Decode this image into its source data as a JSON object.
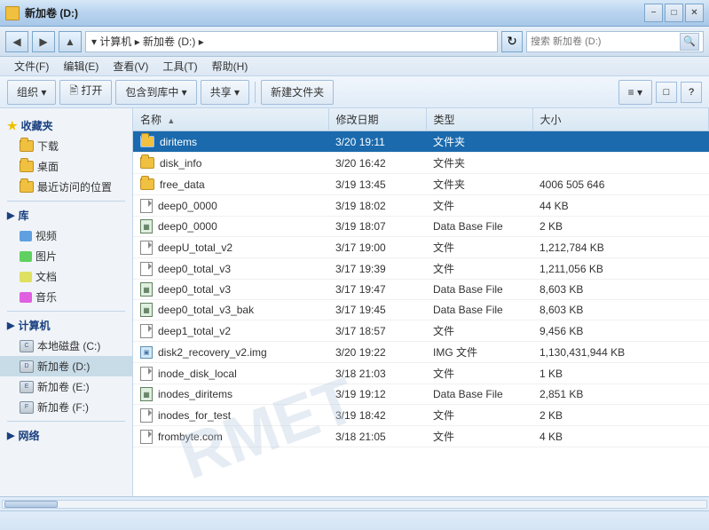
{
  "titleBar": {
    "title": "新加卷 (D:)",
    "icon": "folder",
    "minimizeLabel": "−",
    "maximizeLabel": "□",
    "closeLabel": "✕"
  },
  "addressBar": {
    "backLabel": "◀",
    "forwardLabel": "▶",
    "upLabel": "▲",
    "path": "▾  计算机 ▸ 新加卷 (D:) ▸",
    "refreshLabel": "↻",
    "searchPlaceholder": "搜索 新加卷 (D:)",
    "searchBtnLabel": "🔍"
  },
  "menuBar": {
    "items": [
      {
        "label": "文件(F)"
      },
      {
        "label": "编辑(E)"
      },
      {
        "label": "查看(V)"
      },
      {
        "label": "工具(T)"
      },
      {
        "label": "帮助(H)"
      }
    ]
  },
  "toolbar": {
    "organizeLabel": "组织 ▾",
    "openLabel": "🖹 打开",
    "includeLabel": "包含到库中 ▾",
    "shareLabel": "共享 ▾",
    "newFolderLabel": "新建文件夹",
    "viewLabel": "≡ ▾",
    "viewBtn1": "□",
    "viewBtn2": "?"
  },
  "sidebar": {
    "favoritesStar": "★",
    "favoritesLabel": "收藏夹",
    "downloadLabel": "下载",
    "desktopLabel": "桌面",
    "recentLabel": "最近访问的位置",
    "libraryLabel": "库",
    "videoLabel": "视频",
    "imageLabel": "图片",
    "docLabel": "文档",
    "musicLabel": "音乐",
    "computerLabel": "计算机",
    "localDiskLabel": "本地磁盘 (C:)",
    "newVol1Label": "新加卷 (D:)",
    "newVol2Label": "新加卷 (E:)",
    "newVol3Label": "新加卷 (F:)",
    "networkLabel": "网络"
  },
  "fileList": {
    "columns": [
      {
        "key": "name",
        "label": "名称",
        "sortArrow": "▲"
      },
      {
        "key": "modified",
        "label": "修改日期"
      },
      {
        "key": "type",
        "label": "类型"
      },
      {
        "key": "size",
        "label": "大小"
      }
    ],
    "rows": [
      {
        "name": "diritems",
        "modified": "3/20 19:11",
        "type": "文件夹",
        "size": "",
        "iconType": "folder",
        "selected": true
      },
      {
        "name": "disk_info",
        "modified": "3/20 16:42",
        "type": "文件夹",
        "size": "",
        "iconType": "folder",
        "selected": false
      },
      {
        "name": "free_data",
        "modified": "3/19 13:45",
        "type": "文件夹",
        "size": "4006 505 646",
        "iconType": "folder",
        "selected": false
      },
      {
        "name": "deep0_0000",
        "modified": "3/19 18:02",
        "type": "文件",
        "size": "44 KB",
        "iconType": "file",
        "selected": false
      },
      {
        "name": "deep0_0000",
        "modified": "3/19 18:07",
        "type": "Data Base File",
        "size": "2 KB",
        "iconType": "db",
        "selected": false
      },
      {
        "name": "deepU_total_v2",
        "modified": "3/17 19:00",
        "type": "文件",
        "size": "1,212,784 KB",
        "iconType": "file",
        "selected": false
      },
      {
        "name": "deep0_total_v3",
        "modified": "3/17 19:39",
        "type": "文件",
        "size": "1,211,056 KB",
        "iconType": "file",
        "selected": false
      },
      {
        "name": "deep0_total_v3",
        "modified": "3/17 19:47",
        "type": "Data Base File",
        "size": "8,603 KB",
        "iconType": "db",
        "selected": false
      },
      {
        "name": "deep0_total_v3_bak",
        "modified": "3/17 19:45",
        "type": "Data Base File",
        "size": "8,603 KB",
        "iconType": "db",
        "selected": false
      },
      {
        "name": "deep1_total_v2",
        "modified": "3/17 18:57",
        "type": "文件",
        "size": "9,456 KB",
        "iconType": "file",
        "selected": false
      },
      {
        "name": "disk2_recovery_v2.img",
        "modified": "3/20 19:22",
        "type": "IMG 文件",
        "size": "1,130,431,944 KB",
        "iconType": "img",
        "selected": false
      },
      {
        "name": "inode_disk_local",
        "modified": "3/18 21:03",
        "type": "文件",
        "size": "1 KB",
        "iconType": "file",
        "selected": false
      },
      {
        "name": "inodes_diritems",
        "modified": "3/19 19:12",
        "type": "Data Base File",
        "size": "2,851 KB",
        "iconType": "db",
        "selected": false
      },
      {
        "name": "inodes_for_test",
        "modified": "3/19 18:42",
        "type": "文件",
        "size": "2 KB",
        "iconType": "file",
        "selected": false
      },
      {
        "name": "frombyte.com",
        "modified": "3/18 21:05",
        "type": "文件",
        "size": "4 KB",
        "iconType": "file",
        "selected": false
      }
    ]
  },
  "watermark": "RMET",
  "statusBar": {
    "text": ""
  }
}
